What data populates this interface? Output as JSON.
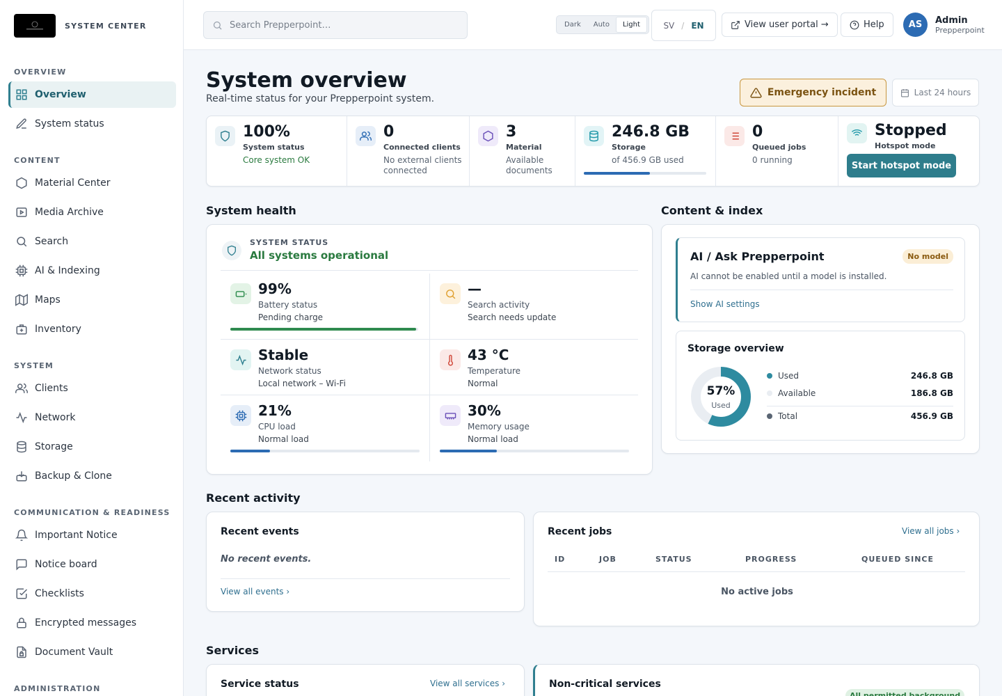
{
  "brand": {
    "name": "SYSTEM CENTER",
    "logo_text": "PREPPERPOINT"
  },
  "sidebar": {
    "sections": [
      {
        "title": "OVERVIEW",
        "items": [
          {
            "label": "Overview",
            "icon": "grid-icon"
          },
          {
            "label": "System status",
            "icon": "pencil-icon"
          }
        ]
      },
      {
        "title": "CONTENT",
        "items": [
          {
            "label": "Material Center",
            "icon": "hexagon-icon"
          },
          {
            "label": "Media Archive",
            "icon": "play-square-icon"
          },
          {
            "label": "Search",
            "icon": "search-icon"
          },
          {
            "label": "AI & Indexing",
            "icon": "cpu-icon"
          },
          {
            "label": "Maps",
            "icon": "map-icon"
          },
          {
            "label": "Inventory",
            "icon": "briefcase-icon"
          }
        ]
      },
      {
        "title": "SYSTEM",
        "items": [
          {
            "label": "Clients",
            "icon": "users-icon"
          },
          {
            "label": "Network",
            "icon": "activity-icon"
          },
          {
            "label": "Storage",
            "icon": "database-icon"
          },
          {
            "label": "Backup & Clone",
            "icon": "backup-icon"
          }
        ]
      },
      {
        "title": "COMMUNICATION & READINESS",
        "items": [
          {
            "label": "Important Notice",
            "icon": "bell-icon"
          },
          {
            "label": "Notice board",
            "icon": "message-square-icon"
          },
          {
            "label": "Checklists",
            "icon": "checkbox-icon"
          },
          {
            "label": "Encrypted messages",
            "icon": "lock-icon"
          },
          {
            "label": "Document Vault",
            "icon": "file-lock-icon"
          }
        ]
      },
      {
        "title": "ADMINISTRATION",
        "items": []
      }
    ]
  },
  "header": {
    "search_placeholder": "Search Prepperpoint…",
    "theme_options": [
      "Dark",
      "Auto",
      "Light"
    ],
    "theme_selected": "Light",
    "languages": [
      "SV",
      "EN"
    ],
    "language_selected": "EN",
    "portal_label": "View user portal →",
    "help_label": "Help",
    "user": {
      "initials": "AS",
      "name": "Admin",
      "org": "Prepperpoint"
    }
  },
  "page": {
    "title": "System overview",
    "subtitle": "Real-time status for your Prepperpoint system.",
    "emergency_label": "Emergency incident",
    "range_label": "Last 24 hours"
  },
  "stats": {
    "system": {
      "value": "100%",
      "label": "System status",
      "note": "Core system OK"
    },
    "clients": {
      "value": "0",
      "label": "Connected clients",
      "note": "No external clients connected"
    },
    "material": {
      "value": "3",
      "label": "Material",
      "note": "Available documents"
    },
    "storage": {
      "value": "246.8 GB",
      "label": "Storage",
      "note": "of 456.9 GB used",
      "used_fraction": 0.54
    },
    "jobs": {
      "value": "0",
      "label": "Queued jobs",
      "note": "0 running"
    },
    "hotspot": {
      "value": "Stopped",
      "label": "Hotspot mode",
      "button": "Start hotspot mode"
    }
  },
  "sections": {
    "health": "System health",
    "content": "Content & index",
    "recent": "Recent activity",
    "services": "Services"
  },
  "health": {
    "status_label": "SYSTEM STATUS",
    "status_value": "All systems operational",
    "metrics": {
      "battery": {
        "value": "99%",
        "label": "Battery status",
        "note": "Pending charge",
        "fraction": 0.99
      },
      "search": {
        "value": "—",
        "label": "Search activity",
        "note": "Search needs update"
      },
      "network": {
        "value": "Stable",
        "label": "Network status",
        "note": "Local network – Wi-Fi"
      },
      "temperature": {
        "value": "43 °C",
        "label": "Temperature",
        "note": "Normal"
      },
      "cpu": {
        "value": "21%",
        "label": "CPU load",
        "note": "Normal load",
        "fraction": 0.21
      },
      "memory": {
        "value": "30%",
        "label": "Memory usage",
        "note": "Normal load",
        "fraction": 0.3
      }
    }
  },
  "ai": {
    "title": "AI / Ask Prepperpoint",
    "badge": "No model",
    "description": "AI cannot be enabled until a model is installed.",
    "link": "Show AI settings"
  },
  "storage_overview": {
    "title": "Storage overview",
    "percent": "57%",
    "percent_value": 0.57,
    "percent_label": "Used",
    "legend": [
      {
        "label": "Used",
        "value": "246.8 GB",
        "color": "#2e8ba0"
      },
      {
        "label": "Available",
        "value": "186.8 GB",
        "color": "#e9edf2"
      },
      {
        "label": "Total",
        "value": "456.9 GB",
        "color": "#5a6573"
      }
    ]
  },
  "events": {
    "title": "Recent events",
    "empty": "No recent events.",
    "link": "View all events"
  },
  "jobs": {
    "title": "Recent jobs",
    "link": "View all jobs",
    "columns": [
      "ID",
      "JOB",
      "STATUS",
      "PROGRESS",
      "QUEUED SINCE"
    ],
    "empty": "No active jobs"
  },
  "services": {
    "status_title": "Service status",
    "status_link": "View all services",
    "noncritical_title": "Non-critical services",
    "noncritical_badge": "All permitted background"
  }
}
